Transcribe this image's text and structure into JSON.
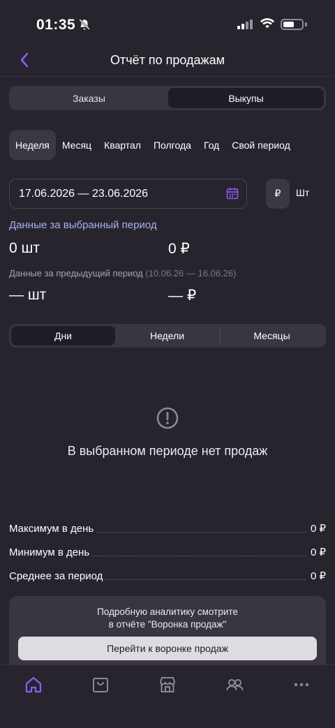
{
  "status_bar": {
    "time": "01:35"
  },
  "header": {
    "title": "Отчёт по продажам"
  },
  "type_tabs": {
    "left": "Заказы",
    "right": "Выкупы"
  },
  "periods": [
    "Неделя",
    "Месяц",
    "Квартал",
    "Полгода",
    "Год",
    "Свой период"
  ],
  "date_range": "17.06.2026 — 23.06.2026",
  "currency_toggle": {
    "currency": "₽",
    "unit": "Шт"
  },
  "current": {
    "label": "Данные за выбранный период",
    "qty": "0 шт",
    "sum": "0 ₽"
  },
  "previous": {
    "label": "Данные за предыдущий период",
    "range": "(10.06.26 — 16.06.26)",
    "qty": "— шт",
    "sum": "— ₽"
  },
  "granularity": [
    "Дни",
    "Недели",
    "Месяцы"
  ],
  "empty_state": "В выбранном периоде нет продаж",
  "stats": [
    {
      "label": "Максимум в день",
      "value": "0 ₽"
    },
    {
      "label": "Минимум в день",
      "value": "0 ₽"
    },
    {
      "label": "Среднее за период",
      "value": "0 ₽"
    }
  ],
  "promo": {
    "line1": "Подробную аналитику смотрите",
    "line2": "в отчёте \"Воронка продаж\"",
    "button": "Перейти к воронке продаж"
  },
  "tabs": [
    "home-icon",
    "bag-icon",
    "store-icon",
    "users-icon",
    "more-icon"
  ],
  "colors": {
    "accent": "#8b5cf6",
    "background": "#28242e",
    "link": "#a9b0f2"
  }
}
